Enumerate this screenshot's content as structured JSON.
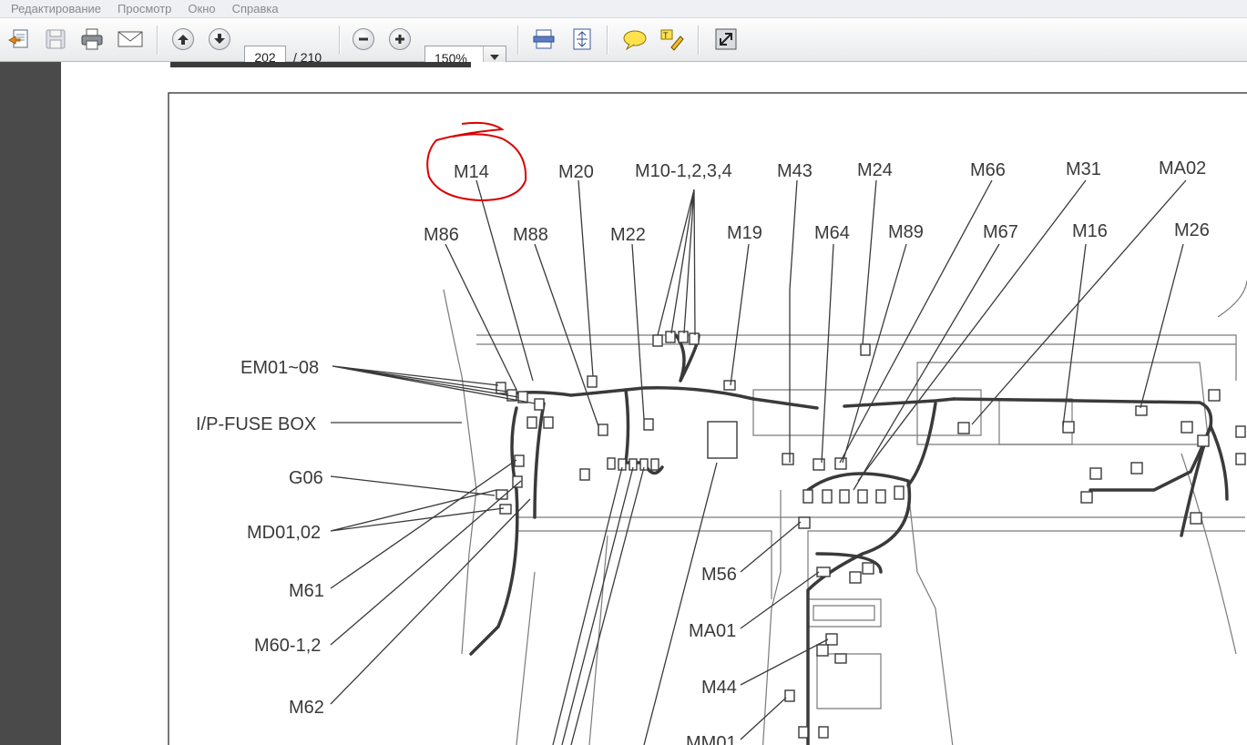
{
  "menu": {
    "items": [
      "Редактирование",
      "Просмотр",
      "Окно",
      "Справка"
    ]
  },
  "toolbar": {
    "buttons": [
      "create-pdf-icon",
      "save-icon",
      "print-icon",
      "email-icon",
      "previous-page-icon",
      "next-page-icon",
      "zoom-out-icon",
      "zoom-in-icon",
      "fit-width-icon",
      "fit-page-icon",
      "comment-icon",
      "highlight-icon",
      "expand-icon"
    ],
    "page_number": "202",
    "page_total": "/ 210",
    "zoom_value": "150%"
  },
  "document": {
    "top_labels": [
      "M14",
      "M20",
      "M10-1,2,3,4",
      "M43",
      "M24",
      "M66",
      "M31",
      "MA02"
    ],
    "second_labels": [
      "M86",
      "M88",
      "M22",
      "M19",
      "M64",
      "M89",
      "M67",
      "M16",
      "M26"
    ],
    "left_labels": [
      "EM01~08",
      "I/P-FUSE BOX",
      "G06",
      "MD01,02",
      "M61",
      "M60-1,2",
      "M62"
    ],
    "center_labels": [
      "M56",
      "MA01",
      "M44",
      "MM01"
    ],
    "annotation_color": "#d80000",
    "line_color": "#3a3a3a"
  }
}
